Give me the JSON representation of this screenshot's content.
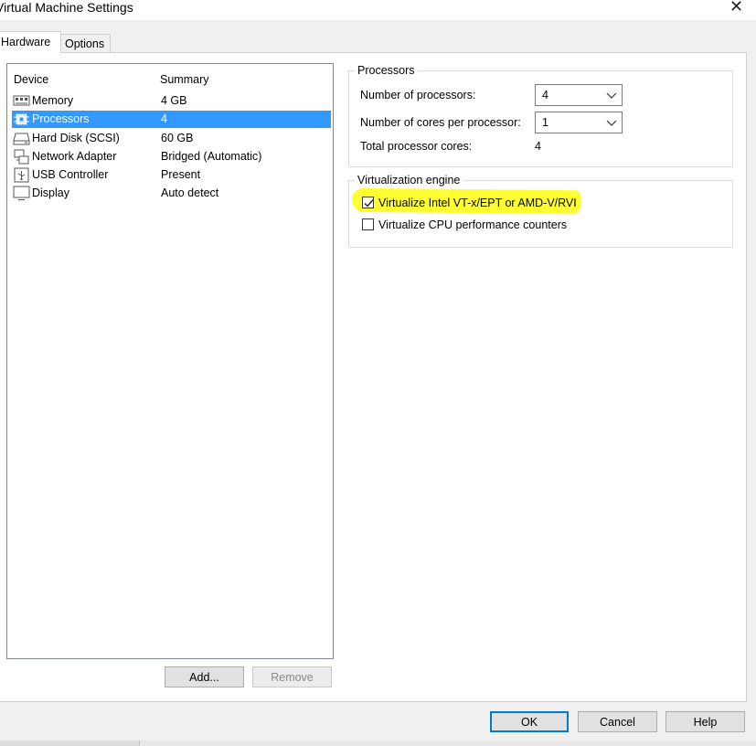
{
  "window": {
    "title": "Virtual Machine Settings",
    "close_icon": "close-icon"
  },
  "tabs": [
    {
      "label": "Hardware",
      "selected": true
    },
    {
      "label": "Options",
      "selected": false
    }
  ],
  "device_list": {
    "headers": {
      "device": "Device",
      "summary": "Summary"
    },
    "rows": [
      {
        "icon": "memory-icon",
        "device": "Memory",
        "summary": "4 GB",
        "selected": false
      },
      {
        "icon": "processor-icon",
        "device": "Processors",
        "summary": "4",
        "selected": true
      },
      {
        "icon": "hard-disk-icon",
        "device": "Hard Disk (SCSI)",
        "summary": "60 GB",
        "selected": false
      },
      {
        "icon": "network-adapter-icon",
        "device": "Network Adapter",
        "summary": "Bridged (Automatic)",
        "selected": false
      },
      {
        "icon": "usb-controller-icon",
        "device": "USB Controller",
        "summary": "Present",
        "selected": false
      },
      {
        "icon": "display-icon",
        "device": "Display",
        "summary": "Auto detect",
        "selected": false
      }
    ],
    "add_label": "Add...",
    "remove_label": "Remove"
  },
  "processors_group": {
    "legend": "Processors",
    "num_processors_label": "Number of processors:",
    "num_processors_value": "4",
    "cores_per_processor_label": "Number of cores per processor:",
    "cores_per_processor_value": "1",
    "total_cores_label": "Total processor cores:",
    "total_cores_value": "4"
  },
  "virtualization_group": {
    "legend": "Virtualization engine",
    "vtx_label": "Virtualize Intel VT-x/EPT or AMD-V/RVI",
    "vtx_checked": true,
    "perf_counters_label": "Virtualize CPU performance counters",
    "perf_counters_checked": false,
    "highlight_color": "#ffff33"
  },
  "footer": {
    "ok_label": "OK",
    "cancel_label": "Cancel",
    "help_label": "Help"
  },
  "colors": {
    "selection": "#3399ff",
    "default_button_border": "#0078d7"
  }
}
